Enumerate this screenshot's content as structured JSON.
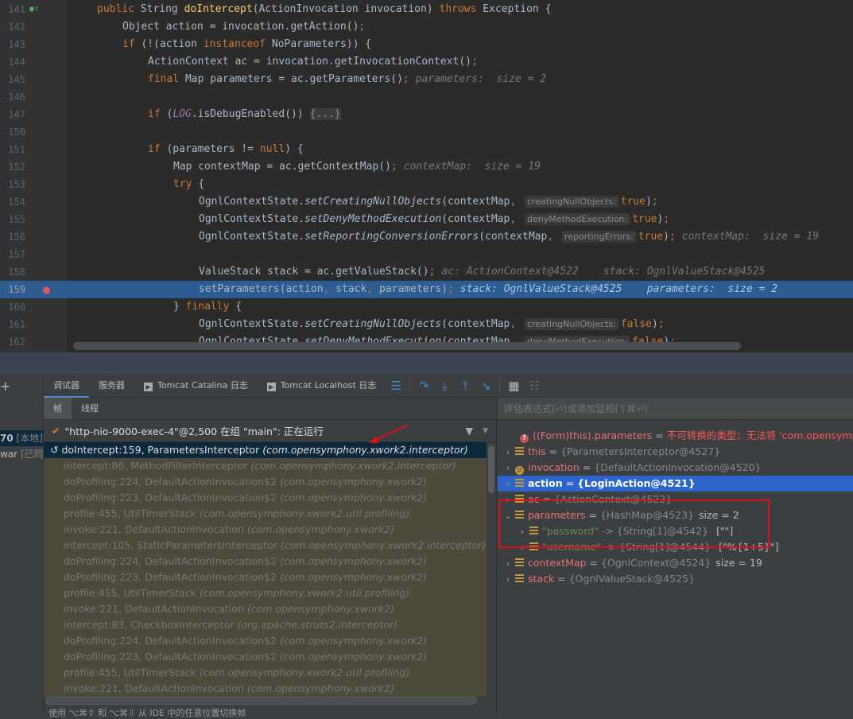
{
  "editor": {
    "lines": [
      {
        "num": "141",
        "indent": 0,
        "tokens": [
          [
            "public ",
            "k"
          ],
          [
            "String ",
            ""
          ],
          [
            "doIntercept",
            "f"
          ],
          [
            "(ActionInvocation invocation) ",
            ""
          ],
          [
            "throws ",
            "k"
          ],
          [
            "Exception {",
            ""
          ]
        ]
      },
      {
        "num": "142",
        "indent": 1,
        "tokens": [
          [
            "Object action = invocation.getAction()",
            ""
          ],
          [
            ";",
            "k"
          ]
        ]
      },
      {
        "num": "143",
        "indent": 1,
        "tokens": [
          [
            "if ",
            "k"
          ],
          [
            "(!(action ",
            ""
          ],
          [
            "instanceof ",
            "k"
          ],
          [
            "NoParameters)) {",
            ""
          ]
        ]
      },
      {
        "num": "144",
        "indent": 2,
        "tokens": [
          [
            "ActionContext ac = invocation.getInvocationContext()",
            ""
          ],
          [
            ";",
            "k"
          ]
        ]
      },
      {
        "num": "145",
        "indent": 2,
        "tokens": [
          [
            "final ",
            "k"
          ],
          [
            "Map parameters = ac.getParameters()",
            ""
          ],
          [
            ";",
            "k"
          ],
          [
            "parameters:  size = 2",
            "h"
          ]
        ]
      },
      {
        "num": "146",
        "indent": 2,
        "tokens": []
      },
      {
        "num": "147",
        "indent": 2,
        "tokens": [
          [
            "if ",
            "k"
          ],
          [
            "(",
            ""
          ],
          [
            "LOG",
            "s"
          ],
          [
            ".isDebugEnabled()) ",
            ""
          ],
          [
            "{...}",
            "fd"
          ]
        ]
      },
      {
        "num": "150",
        "indent": 2,
        "tokens": []
      },
      {
        "num": "151",
        "indent": 2,
        "tokens": [
          [
            "if ",
            "k"
          ],
          [
            "(parameters != ",
            ""
          ],
          [
            "null",
            "k"
          ],
          [
            ") {",
            ""
          ]
        ]
      },
      {
        "num": "152",
        "indent": 3,
        "tokens": [
          [
            "Map contextMap = ac.getContextMap()",
            ""
          ],
          [
            ";",
            "k"
          ],
          [
            "contextMap:  size = 19",
            "h"
          ]
        ]
      },
      {
        "num": "153",
        "indent": 3,
        "tokens": [
          [
            "try ",
            "k"
          ],
          [
            "{",
            ""
          ]
        ]
      },
      {
        "num": "154",
        "indent": 4,
        "tokens": [
          [
            "OgnlContextState.",
            ""
          ],
          [
            "setCreatingNullObjects",
            "i"
          ],
          [
            "(contextMap",
            ""
          ],
          [
            ", ",
            "k"
          ],
          [
            "creatingNullObjects:",
            "b"
          ],
          [
            "true",
            "k"
          ],
          [
            ")",
            ""
          ],
          [
            ";",
            "k"
          ]
        ]
      },
      {
        "num": "155",
        "indent": 4,
        "tokens": [
          [
            "OgnlContextState.",
            ""
          ],
          [
            "setDenyMethodExecution",
            "i"
          ],
          [
            "(contextMap",
            ""
          ],
          [
            ", ",
            "k"
          ],
          [
            "denyMethodExecution:",
            "b"
          ],
          [
            "true",
            "k"
          ],
          [
            ")",
            ""
          ],
          [
            ";",
            "k"
          ]
        ]
      },
      {
        "num": "156",
        "indent": 4,
        "tokens": [
          [
            "OgnlContextState.",
            ""
          ],
          [
            "setReportingConversionErrors",
            "i"
          ],
          [
            "(contextMap",
            ""
          ],
          [
            ", ",
            "k"
          ],
          [
            "reportingErrors:",
            "b"
          ],
          [
            "true",
            "k"
          ],
          [
            ")",
            ""
          ],
          [
            ";",
            "k"
          ],
          [
            "contextMap:  size = 19",
            "h"
          ]
        ]
      },
      {
        "num": "157",
        "indent": 4,
        "tokens": []
      },
      {
        "num": "158",
        "indent": 4,
        "tokens": [
          [
            "ValueStack stack = ac.getValueStack()",
            ""
          ],
          [
            ";",
            "k"
          ],
          [
            "ac: ActionContext@4522    stack: OgnlValueStack@4525",
            "h"
          ]
        ]
      },
      {
        "num": "159",
        "indent": 4,
        "current": true,
        "tokens": [
          [
            "setParameters(action",
            ""
          ],
          [
            ", ",
            "k"
          ],
          [
            "stack",
            ""
          ],
          [
            ", ",
            "k"
          ],
          [
            "parameters)",
            ""
          ],
          [
            ";",
            "k"
          ],
          [
            "stack: OgnlValueStack@4525    parameters:  size = 2",
            "h"
          ]
        ]
      },
      {
        "num": "160",
        "indent": 3,
        "tokens": [
          [
            "} ",
            ""
          ],
          [
            "finally ",
            "k"
          ],
          [
            "{",
            ""
          ]
        ]
      },
      {
        "num": "161",
        "indent": 4,
        "tokens": [
          [
            "OgnlContextState.",
            ""
          ],
          [
            "setCreatingNullObjects",
            "i"
          ],
          [
            "(contextMap",
            ""
          ],
          [
            ", ",
            "k"
          ],
          [
            "creatingNullObjects:",
            "b"
          ],
          [
            "false",
            "k"
          ],
          [
            ")",
            ""
          ],
          [
            ";",
            "k"
          ]
        ]
      },
      {
        "num": "162",
        "indent": 4,
        "tokens": [
          [
            "OgnlContextState.",
            ""
          ],
          [
            "setDenyMethodExecution",
            "i"
          ],
          [
            "(contextMap",
            ""
          ],
          [
            ", ",
            "k"
          ],
          [
            "denyMethodExecution:",
            "b"
          ],
          [
            "false",
            "k"
          ],
          [
            ")",
            ""
          ],
          [
            ";",
            "k"
          ]
        ]
      }
    ]
  },
  "leftcol": {
    "plus": "+",
    "item1_num": "70",
    "item1_tag": "[本地]",
    "item2_name": "war",
    "item2_tag": "[已同"
  },
  "tabs": {
    "debugger": "调试器",
    "server": "服务器",
    "catalina": "Tomcat Catalina 日志",
    "localhost": "Tomcat Localhost 日志"
  },
  "frames": {
    "subtabs": {
      "frames": "帧",
      "threads": "线程"
    },
    "thread": "\"http-nio-9000-exec-4\"@2,500 在组 \"main\": 正在运行",
    "list": [
      [
        "doIntercept:159, ParametersInterceptor",
        "(com.opensymphony.xwork2.interceptor)"
      ],
      [
        "intercept:86, MethodFilterInterceptor",
        "(com.opensymphony.xwork2.interceptor)"
      ],
      [
        "doProfiling:224, DefaultActionInvocation$2",
        "(com.opensymphony.xwork2)"
      ],
      [
        "doProfiling:223, DefaultActionInvocation$2",
        "(com.opensymphony.xwork2)"
      ],
      [
        "profile:455, UtilTimerStack",
        "(com.opensymphony.xwork2.util.profiling)"
      ],
      [
        "invoke:221, DefaultActionInvocation",
        "(com.opensymphony.xwork2)"
      ],
      [
        "intercept:105, StaticParametersInterceptor",
        "(com.opensymphony.xwork2.interceptor)"
      ],
      [
        "doProfiling:224, DefaultActionInvocation$2",
        "(com.opensymphony.xwork2)"
      ],
      [
        "doProfiling:223, DefaultActionInvocation$2",
        "(com.opensymphony.xwork2)"
      ],
      [
        "profile:455, UtilTimerStack",
        "(com.opensymphony.xwork2.util.profiling)"
      ],
      [
        "invoke:221, DefaultActionInvocation",
        "(com.opensymphony.xwork2)"
      ],
      [
        "intercept:83, CheckboxInterceptor",
        "(org.apache.struts2.interceptor)"
      ],
      [
        "doProfiling:224, DefaultActionInvocation$2",
        "(com.opensymphony.xwork2)"
      ],
      [
        "doProfiling:223, DefaultActionInvocation$2",
        "(com.opensymphony.xwork2)"
      ],
      [
        "profile:455, UtilTimerStack",
        "(com.opensymphony.xwork2.util.profiling)"
      ],
      [
        "invoke:221, DefaultActionInvocation",
        "(com.opensymphony.xwork2)"
      ]
    ],
    "hint": "使用 ⌥⌘⇧ 和 ⌥⌘⇩ 从 IDE 中的任意位置切换帧"
  },
  "vars": {
    "eval_placeholder": "评估表达式(⏎)或添加监视(⇧⌘⏎)",
    "error": {
      "name": "((Form)this).parameters",
      "value": "不可转换的类型；无法将 'com.opensymp"
    },
    "rows": [
      {
        "name": "this",
        "value": "{ParametersInterceptor@4527}",
        "icon": "field"
      },
      {
        "name": "invocation",
        "value": "{DefaultActionInvocation@4520}",
        "icon": "param"
      },
      {
        "name": "action",
        "value": "{LoginAction@4521}",
        "icon": "field",
        "selected": true
      },
      {
        "name": "ac",
        "value": "{ActionContext@4522}",
        "icon": "field"
      },
      {
        "name": "parameters",
        "value": "{HashMap@4523}",
        "size": "size = 2",
        "icon": "field",
        "expanded": true
      },
      {
        "key": "\"password\"",
        "value": "-> {String[1]@4542}",
        "extra": "[\"\"]",
        "child": true
      },
      {
        "key": "\"username\"",
        "value": "-> {String[1]@4544}",
        "extra": "[\"%{1+5}\"]",
        "child": true
      },
      {
        "name": "contextMap",
        "value": "{OgnlContext@4524}",
        "size": "size = 19",
        "icon": "field"
      },
      {
        "name": "stack",
        "value": "{OgnlValueStack@4525}",
        "icon": "field"
      }
    ]
  },
  "colors": {
    "keyword": "#cc7832",
    "method": "#ffc66d",
    "current_line": "#2d5c92",
    "selected_var": "#2f65ca",
    "highlight_box": "#e0101a"
  }
}
